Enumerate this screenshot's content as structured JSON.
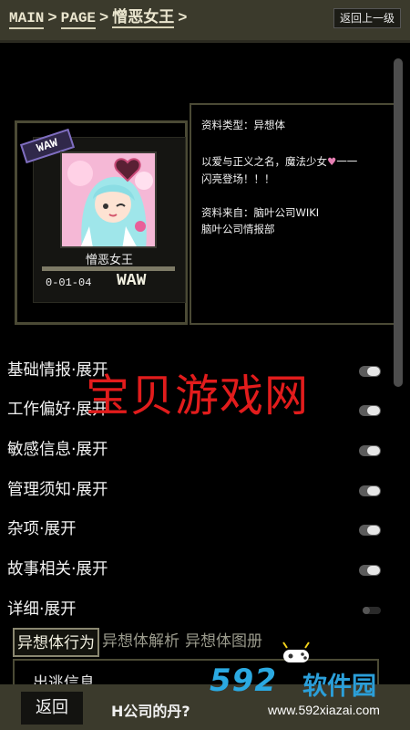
{
  "header": {
    "breadcrumbs": [
      "MAIN",
      "PAGE",
      "憎恶女王"
    ],
    "separator": ">",
    "back_label": "返回上一级"
  },
  "card": {
    "badge": "WAW",
    "name": "憎恶女王",
    "code": "0-01-04",
    "level": "WAW"
  },
  "info": {
    "type_line": "资料类型：异想体",
    "quote_line1_a": "以爱与正义之名，魔法少女",
    "quote_line1_b": "一一",
    "quote_line2": "闪亮登场！！！",
    "source_line1": "资料来自：脑叶公司WIKI",
    "source_line2": "脑叶公司情报部"
  },
  "sections": [
    {
      "label": "基础情报·展开"
    },
    {
      "label": "工作偏好·展开"
    },
    {
      "label": "敏感信息·展开"
    },
    {
      "label": "管理须知·展开"
    },
    {
      "label": "杂项·展开"
    },
    {
      "label": "故事相关·展开"
    },
    {
      "label": "详细·展开"
    }
  ],
  "watermark_text": "宝贝游戏网",
  "tabs": [
    {
      "label": "异想体行为"
    },
    {
      "label": "异想体解析"
    },
    {
      "label": "异想体图册"
    }
  ],
  "subpanel_label": "出逃信息",
  "bottom": {
    "back_label": "返回",
    "question": "H公司的丹?"
  },
  "logo": {
    "number": "592",
    "name": "软件园",
    "url": "www.592xiazai.com"
  }
}
